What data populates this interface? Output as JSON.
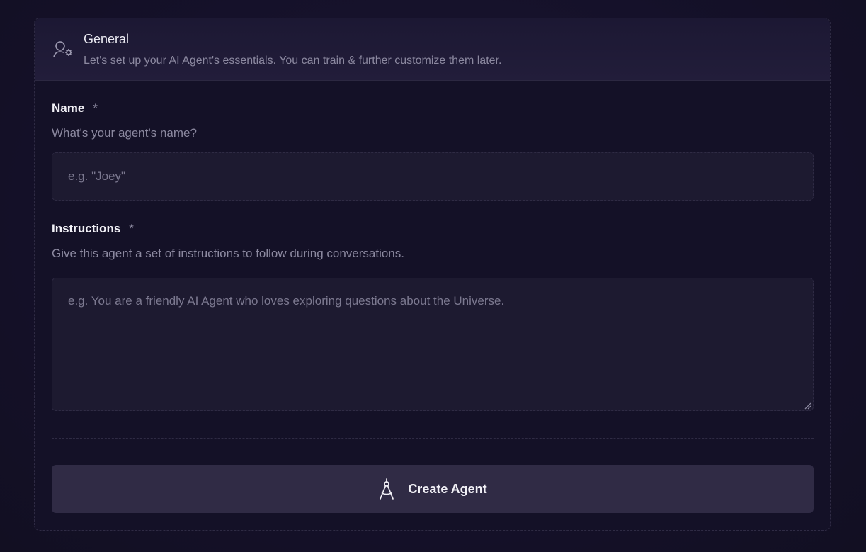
{
  "header": {
    "icon": "user-gear-icon",
    "title": "General",
    "subtitle": "Let's set up your AI Agent's essentials. You can train & further customize them later."
  },
  "name_field": {
    "label": "Name",
    "required_mark": "*",
    "description": "What's your agent's name?",
    "placeholder": "e.g. \"Joey\"",
    "value": ""
  },
  "instructions_field": {
    "label": "Instructions",
    "required_mark": "*",
    "description": "Give this agent a set of instructions to follow during conversations.",
    "placeholder": "e.g. You are a friendly AI Agent who loves exploring questions about the Universe.",
    "value": ""
  },
  "submit": {
    "icon": "compass-drawing-icon",
    "label": "Create Agent"
  },
  "colors": {
    "background": "#15112a",
    "card": "#141127",
    "input": "#1d1a30",
    "button": "#302b45",
    "muted_text": "#8c89a0"
  }
}
